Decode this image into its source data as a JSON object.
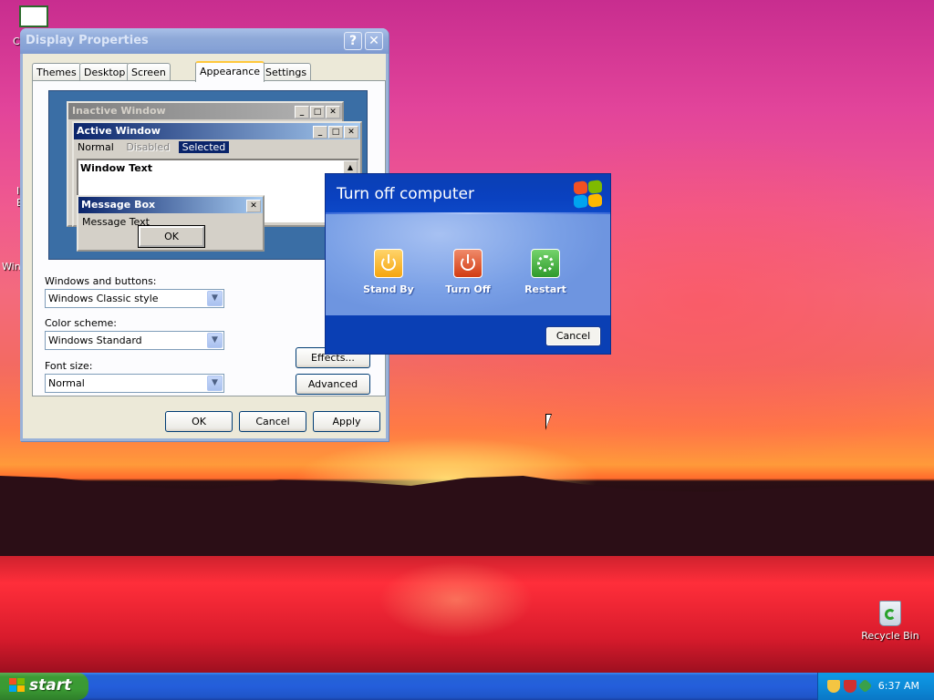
{
  "desktop": {
    "edge_labels": [
      "C",
      "I",
      "E",
      "Win"
    ],
    "recycle_bin_label": "Recycle Bin"
  },
  "display_properties": {
    "title": "Display Properties",
    "help_glyph": "?",
    "close_glyph": "✕",
    "tabs": [
      "Themes",
      "Desktop",
      "Screen Saver",
      "Appearance",
      "Settings"
    ],
    "active_tab": "Appearance",
    "preview": {
      "inactive_title": "Inactive Window",
      "active_title": "Active Window",
      "menu_normal": "Normal",
      "menu_disabled": "Disabled",
      "menu_selected": "Selected",
      "window_text": "Window Text",
      "message_box_title": "Message Box",
      "message_text": "Message Text",
      "ok": "OK"
    },
    "windows_buttons_label": "Windows and buttons:",
    "windows_buttons_value": "Windows Classic style",
    "color_scheme_label": "Color scheme:",
    "color_scheme_value": "Windows Standard",
    "font_size_label": "Font size:",
    "font_size_value": "Normal",
    "effects_button": "Effects...",
    "advanced_button": "Advanced",
    "ok_button": "OK",
    "cancel_button": "Cancel",
    "apply_button": "Apply"
  },
  "turn_off": {
    "title": "Turn off computer",
    "options": [
      {
        "label": "Stand By",
        "icon": "standby-icon"
      },
      {
        "label": "Turn Off",
        "icon": "power-icon"
      },
      {
        "label": "Restart",
        "icon": "restart-icon"
      }
    ],
    "cancel_button": "Cancel"
  },
  "taskbar": {
    "start_label": "start",
    "clock": "6:37 AM"
  },
  "colors": {
    "xp_blue": "#0a3fb4",
    "start_green": "#3c9b35",
    "tab_highlight": "#ffc83c"
  }
}
